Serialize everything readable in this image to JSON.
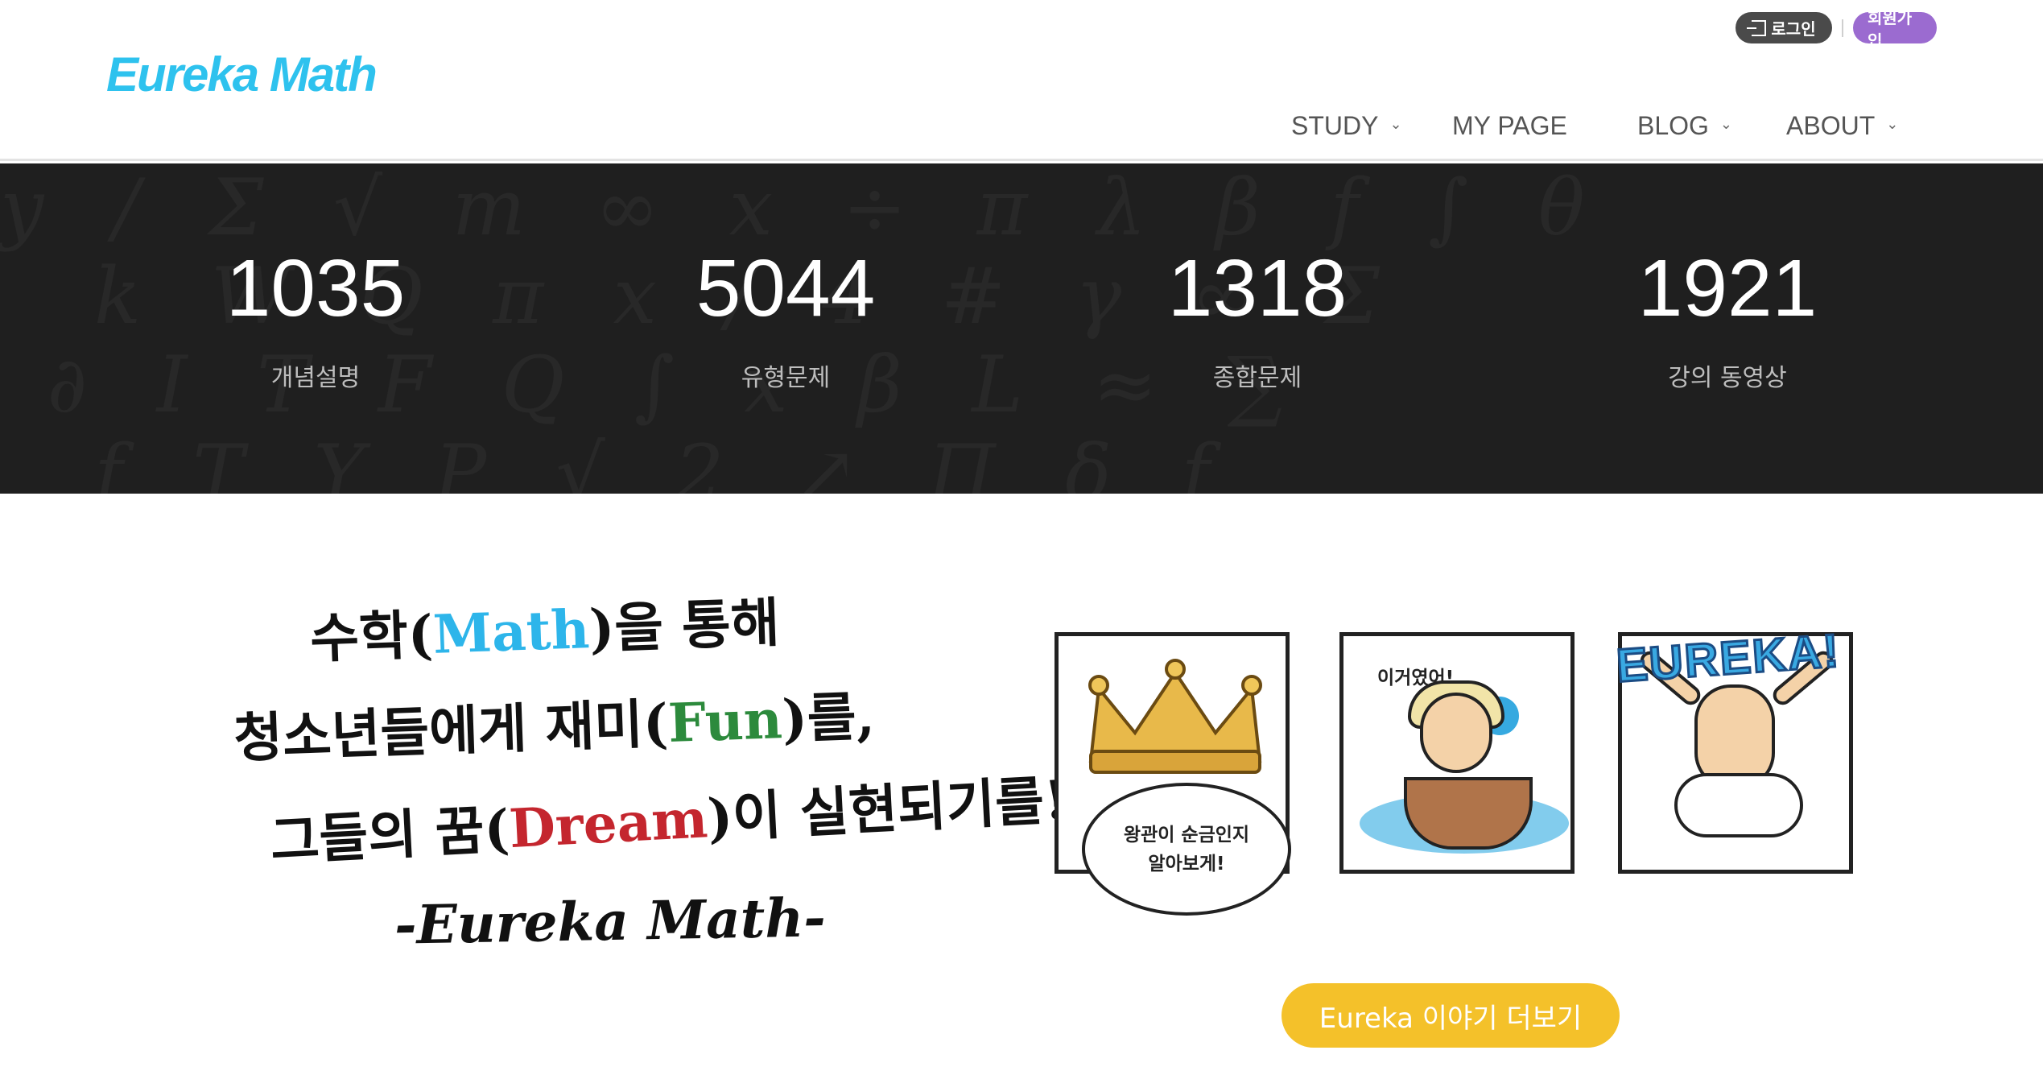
{
  "header": {
    "logo": "Eureka Math",
    "auth": {
      "login": "로그인",
      "signup": "회원가입"
    },
    "nav": [
      {
        "label": "STUDY",
        "dropdown": true
      },
      {
        "label": "MY PAGE",
        "dropdown": false
      },
      {
        "label": "BLOG",
        "dropdown": true
      },
      {
        "label": "ABOUT",
        "dropdown": true
      }
    ]
  },
  "stats": [
    {
      "value": "1035",
      "label": "개념설명"
    },
    {
      "value": "5044",
      "label": "유형문제"
    },
    {
      "value": "1318",
      "label": "종합문제"
    },
    {
      "value": "1921",
      "label": "강의 동영상"
    }
  ],
  "calligraphy": {
    "line1": {
      "a": "수학(",
      "b": "Math",
      "c": ")을 통해"
    },
    "line2": {
      "a": "청소년들에게 재미(",
      "b": "Fun",
      "c": ")를,"
    },
    "line3": {
      "a": "그들의 꿈(",
      "b": "Dream",
      "c": ")이 실현되기를!!"
    },
    "line4": "-Eureka Math-"
  },
  "comic": {
    "panel1_bubble_line1": "왕관이 순금인지",
    "panel1_bubble_line2": "알아보게!",
    "panel2_text": "이거였어!",
    "panel2_alert": "!",
    "panel3_title": "EUREKA!"
  },
  "more_button": "Eureka 이야기 더보기",
  "colors": {
    "logo": "#2ec2ee",
    "login_pill": "#4a4a4a",
    "signup_pill": "#9b6bd0",
    "stats_bg": "#1f1f1f",
    "more_button": "#f4c12a"
  }
}
